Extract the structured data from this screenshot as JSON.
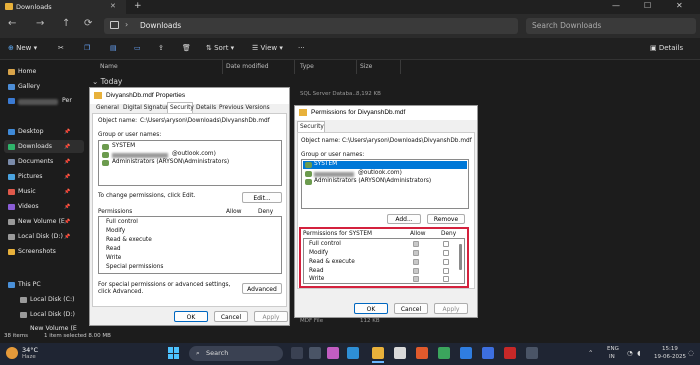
{
  "explorer": {
    "tab_title": "Downloads",
    "tab_close": "✕",
    "tab_add": "+",
    "window_controls": [
      "—",
      "☐",
      "✕"
    ],
    "address": "Downloads",
    "search_placeholder": "Search Downloads",
    "toolbar": {
      "new": "New",
      "sort": "Sort",
      "view": "View",
      "details": "Details"
    },
    "columns": [
      "Name",
      "Date modified",
      "Type",
      "Size"
    ],
    "group_today": "Today",
    "rows": [
      {
        "type": "SQL Server Databa...",
        "size": "8,192 KB"
      },
      {
        "type": "MDF File",
        "size": "112 KB"
      }
    ],
    "sidebar": {
      "items": [
        "Home",
        "Gallery",
        "Per",
        "Desktop",
        "Downloads",
        "Documents",
        "Pictures",
        "Music",
        "Videos",
        "New Volume (E",
        "Local Disk (D:)",
        "Screenshots",
        "This PC",
        "Local Disk (C:)",
        "Local Disk (D:)",
        "New Volume (E"
      ]
    },
    "status": {
      "items": "38 items",
      "selected": "1 item selected  8.00 MB"
    }
  },
  "properties": {
    "title": "DivyanshDb.mdf Properties",
    "tabs": [
      "General",
      "Digital Signatures",
      "Security",
      "Details",
      "Previous Versions"
    ],
    "object_label": "Object name:",
    "object_value": "C:\\Users\\aryson\\Downloads\\DivyanshDb.mdf",
    "group_label": "Group or user names:",
    "users": [
      "SYSTEM",
      "@outlook.com)",
      "Administrators (ARYSON\\Administrators)"
    ],
    "change_text": "To change permissions, click Edit.",
    "edit_btn": "Edit...",
    "perm_label": "Permissions",
    "allow": "Allow",
    "deny": "Deny",
    "perms": [
      "Full control",
      "Modify",
      "Read & execute",
      "Read",
      "Write",
      "Special permissions"
    ],
    "special_text": "For special permissions or advanced settings, click Advanced.",
    "advanced_btn": "Advanced",
    "ok": "OK",
    "cancel": "Cancel",
    "apply": "Apply"
  },
  "permissions": {
    "title": "Permissions for DivyanshDb.mdf",
    "tab": "Security",
    "object_label": "Object name:",
    "object_value": "C:\\Users\\aryson\\Downloads\\DivyanshDb.mdf",
    "group_label": "Group or user names:",
    "users": [
      "SYSTEM",
      "@outlook.com)",
      "Administrators (ARYSON\\Administrators)"
    ],
    "add_btn": "Add...",
    "remove_btn": "Remove",
    "perm_for": "Permissions for SYSTEM",
    "allow": "Allow",
    "deny": "Deny",
    "perms": [
      "Full control",
      "Modify",
      "Read & execute",
      "Read",
      "Write"
    ],
    "ok": "OK",
    "cancel": "Cancel",
    "apply": "Apply"
  },
  "taskbar": {
    "temp": "34°C",
    "weather": "Haze",
    "search": "Search",
    "lang1": "ENG",
    "lang2": "IN",
    "time": "15:19",
    "date": "19-06-2025"
  }
}
